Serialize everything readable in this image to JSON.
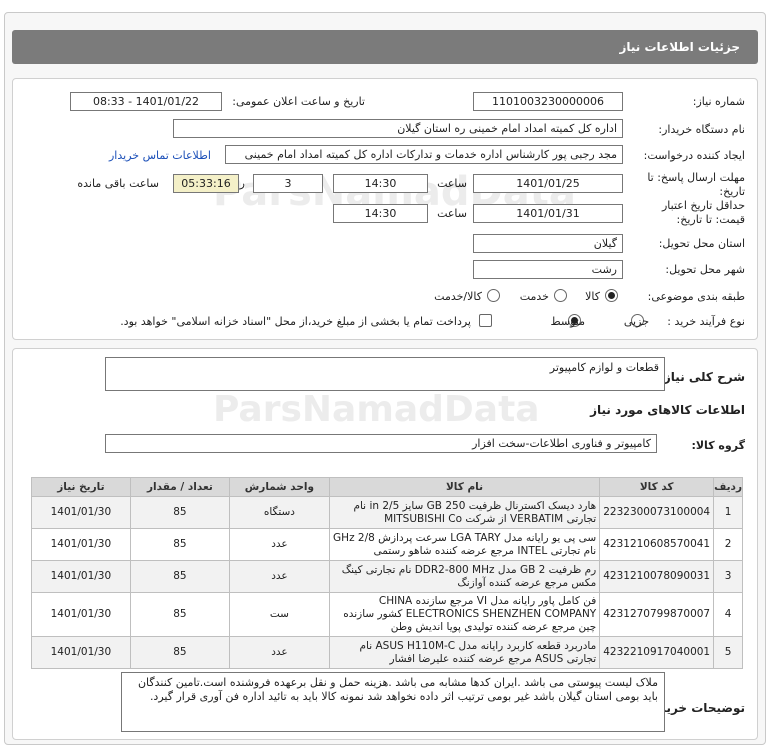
{
  "header": {
    "title": "جزئیات اطلاعات نیاز"
  },
  "need": {
    "number_label": "شماره نیاز:",
    "number": "1101003230000006",
    "announce_label": "تاریخ و ساعت اعلان عمومی:",
    "announce": "1401/01/22 - 08:33",
    "buyer_label": "نام دستگاه خریدار:",
    "buyer": "اداره کل کمیته امداد امام خمینی  ره  استان گیلان",
    "creator_label": "ایجاد کننده درخواست:",
    "creator": "مجد رجبی پور کارشناس اداره خدمات و تدارکات اداره کل کمیته امداد امام خمینی",
    "contact_link": "اطلاعات تماس خریدار",
    "deadline_label_1": "مهلت ارسال پاسخ: تا",
    "deadline_label_2": "تاریخ:",
    "deadline_date": "1401/01/25",
    "time_label": "ساعت",
    "deadline_time": "14:30",
    "days": "3",
    "days_label": "روز و",
    "remaining": "05:33:16",
    "remaining_label": "ساعت باقی مانده",
    "validity_label_1": "حداقل تاریخ اعتبار",
    "validity_label_2": "قیمت: تا تاریخ:",
    "validity_date": "1401/01/31",
    "validity_time": "14:30",
    "province_label": "استان محل تحویل:",
    "province": "گیلان",
    "city_label": "شهر محل تحویل:",
    "city": "رشت",
    "category_label": "طبقه بندی موضوعی:",
    "category_options": [
      "کالا",
      "خدمت",
      "کالا/خدمت"
    ],
    "process_label": "نوع فرآیند خرید :",
    "process_options": [
      "جزیی",
      "متوسط"
    ],
    "payment_note": "پرداخت تمام یا بخشی از مبلغ خرید،از محل \"اسناد خزانه اسلامی\" خواهد بود."
  },
  "summary": {
    "title_label": "شرح کلی نیاز:",
    "title": "قطعات و لوازم کامپیوتر",
    "goods_info_label": "اطلاعات کالاهای مورد نیاز",
    "group_label": "گروه کالا:",
    "group": "کامپیوتر و فناوری اطلاعات-سخت افزار"
  },
  "table": {
    "headers": [
      "ردیف",
      "کد کالا",
      "نام کالا",
      "واحد شمارش",
      "تعداد / مقدار",
      "تاریخ نیاز"
    ],
    "rows": [
      {
        "idx": "1",
        "code": "2232300073100004",
        "name": "هارد دیسک اکسترنال ظرفیت GB 250 سایز in 2/5 نام تجارتی VERBATIM از شرکت MITSUBISHI Co",
        "unit": "دستگاه",
        "qty": "85",
        "date": "1401/01/30"
      },
      {
        "idx": "2",
        "code": "4231210608570041",
        "name": "سی پی یو رایانه مدل LGA TARY سرعت پردازش GHz 2/8 نام تجارتی INTEL مرجع عرضه کننده شاهو رستمی",
        "unit": "عدد",
        "qty": "85",
        "date": "1401/01/30"
      },
      {
        "idx": "3",
        "code": "4231210078090031",
        "name": "رم ظرفیت GB 2 مدل DDR2-800 MHz نام تجارتی کینگ مکس مرجع عرضه کننده آوازنگ",
        "unit": "عدد",
        "qty": "85",
        "date": "1401/01/30"
      },
      {
        "idx": "4",
        "code": "4231270799870007",
        "name": "فن کامل پاور رایانه مدل VI مرجع سازنده CHINA ELECTRONICS SHENZHEN COMPANY کشور سازنده چین مرجع عرضه کننده تولیدی پویا اندیش وطن",
        "unit": "ست",
        "qty": "85",
        "date": "1401/01/30"
      },
      {
        "idx": "5",
        "code": "4232210917040001",
        "name": "مادربرد قطعه کاربرد رایانه مدل ASUS H110M-C نام تجارتی ASUS مرجع عرضه کننده علیرضا افشار",
        "unit": "عدد",
        "qty": "85",
        "date": "1401/01/30"
      }
    ]
  },
  "buyer_notes": {
    "label": "توضیحات خریدار:",
    "text": "ملاک لیست پیوستی می باشد .ایران کدها مشابه می باشد .هزینه حمل و نقل برعهده فروشنده است.تامین کنندگان باید بومی استان گیلان باشد غیر بومی ترتیب اثر داده نخواهد شد نمونه کالا باید به تائید اداره فن آوری قرار گیرد."
  },
  "watermark": {
    "text": "ParsNamadData"
  }
}
